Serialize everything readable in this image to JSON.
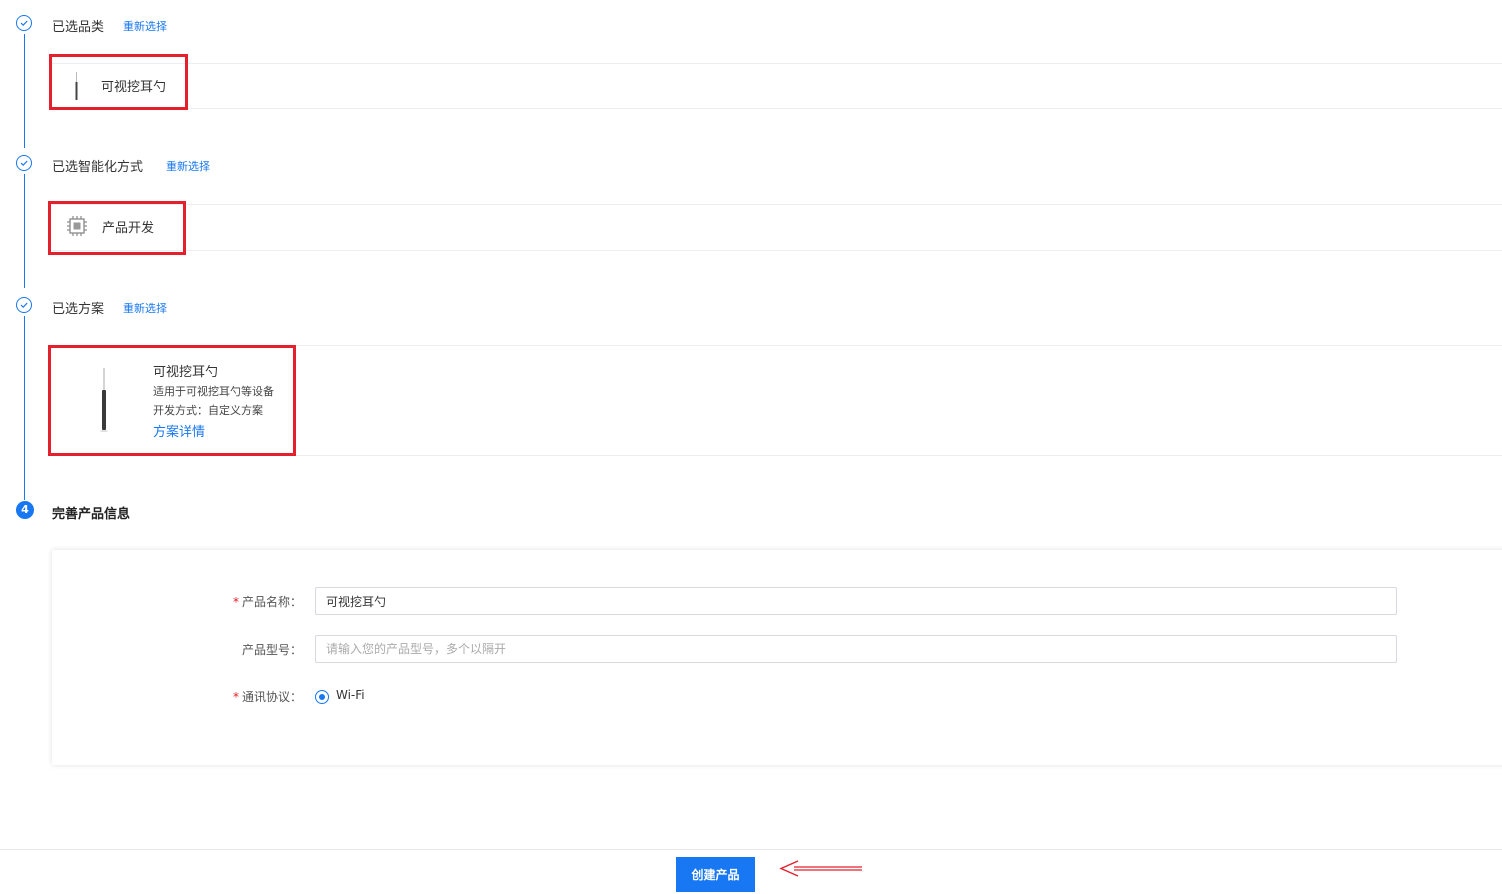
{
  "steps": [
    {
      "title": "已选品类",
      "reselect": "重新选择",
      "card_label": "可视挖耳勺"
    },
    {
      "title": "已选智能化方式",
      "reselect": "重新选择",
      "card_label": "产品开发"
    },
    {
      "title": "已选方案",
      "reselect": "重新选择",
      "card": {
        "name": "可视挖耳勺",
        "desc": "适用于可视挖耳勺等设备",
        "dev_mode": "开发方式：自定义方案",
        "detail_link": "方案详情"
      }
    },
    {
      "number": "4",
      "title": "完善产品信息"
    }
  ],
  "form": {
    "name_label": "产品名称：",
    "name_value": "可视挖耳勺",
    "model_label": "产品型号：",
    "model_placeholder": "请输入您的产品型号，多个以隔开",
    "protocol_label": "通讯协议：",
    "protocol_option": "Wi-Fi",
    "required_mark": "*"
  },
  "footer": {
    "create_button": "创建产品"
  },
  "colors": {
    "accent": "#1877f2",
    "highlight": "#e3202b"
  }
}
